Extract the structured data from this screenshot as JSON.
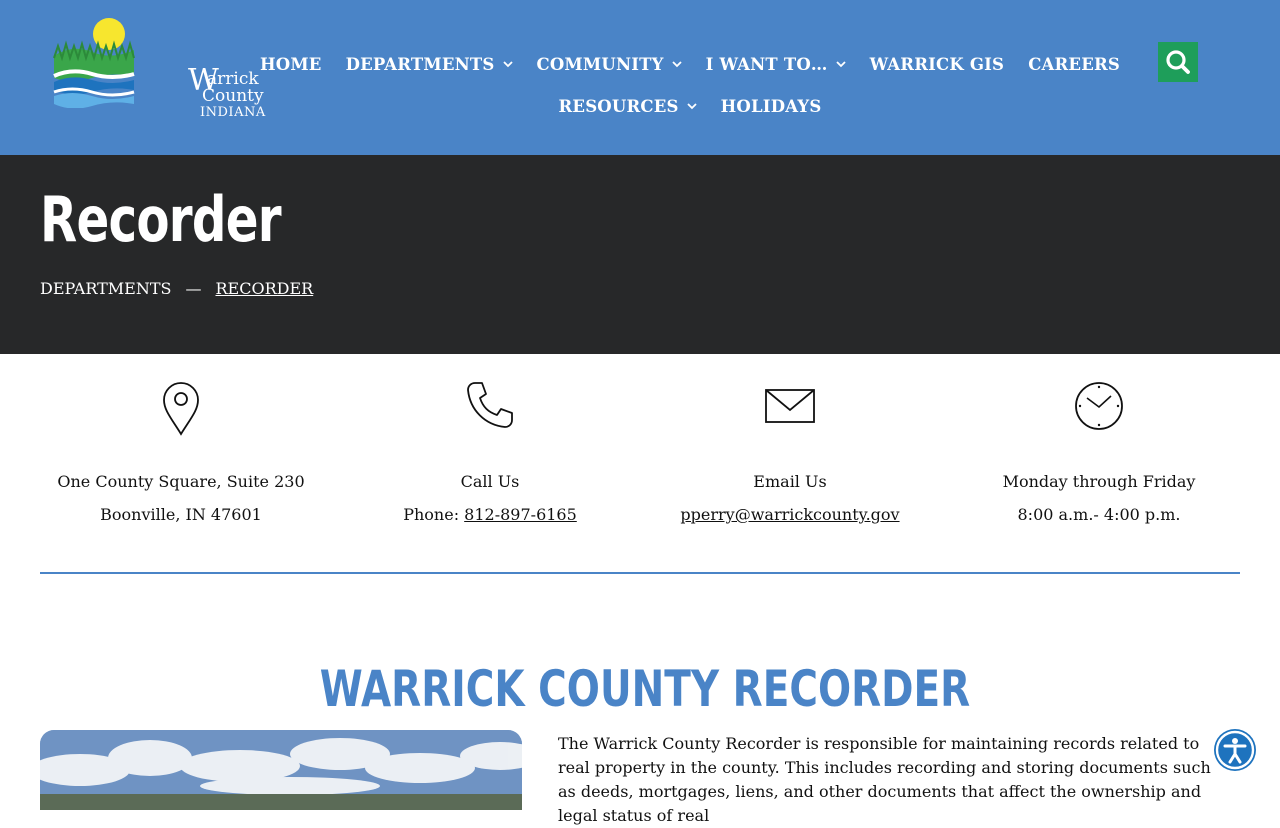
{
  "header": {
    "logo": {
      "w": "W",
      "arrick": "arrick",
      "county": "County",
      "indiana": "INDIANA"
    },
    "nav_row1": [
      {
        "label": "HOME",
        "dropdown": false
      },
      {
        "label": "DEPARTMENTS",
        "dropdown": true
      },
      {
        "label": "COMMUNITY",
        "dropdown": true
      },
      {
        "label": "I WANT TO…",
        "dropdown": true
      },
      {
        "label": "WARRICK GIS",
        "dropdown": false
      },
      {
        "label": "CAREERS",
        "dropdown": false
      }
    ],
    "nav_row2": [
      {
        "label": "RESOURCES",
        "dropdown": true
      },
      {
        "label": "HOLIDAYS",
        "dropdown": false
      }
    ],
    "search_icon": "search-icon",
    "colors": {
      "header_bg": "#4a84c7",
      "search_bg": "#1e9e5a"
    }
  },
  "hero": {
    "title": "Recorder",
    "breadcrumb": {
      "parent": "DEPARTMENTS",
      "separator": "—",
      "current": "RECORDER"
    },
    "bg": "#272829"
  },
  "contact": {
    "address": {
      "icon": "map-pin-icon",
      "line1": "One County Square, Suite 230",
      "line2": "Boonville, IN 47601"
    },
    "phone": {
      "icon": "phone-icon",
      "line1": "Call Us",
      "prefix": "Phone: ",
      "number": "812-897-6165"
    },
    "email": {
      "icon": "envelope-icon",
      "line1": "Email Us",
      "address": "pperry@warrickcounty.gov"
    },
    "hours": {
      "icon": "clock-icon",
      "line1": "Monday through Friday",
      "line2": "8:00 a.m.- 4:00 p.m."
    }
  },
  "main": {
    "section_title": "WARRICK COUNTY RECORDER",
    "intro": "The Warrick County Recorder is responsible for maintaining records related to real property in the county. This includes recording and storing documents such as deeds, mortgages, liens, and other documents that affect the ownership and legal status of real",
    "accent": "#4a84c7"
  },
  "accessibility": {
    "icon": "accessibility-icon",
    "color": "#1e73be"
  }
}
